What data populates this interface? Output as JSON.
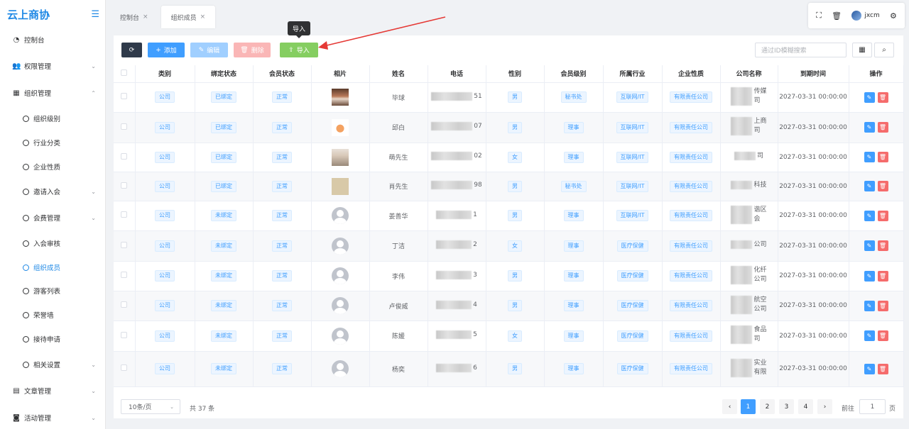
{
  "app": {
    "logo": "云上商协"
  },
  "sidebar": {
    "items": [
      {
        "label": "控制台",
        "icon": "dashboard-icon"
      },
      {
        "label": "权限管理",
        "icon": "users-icon"
      },
      {
        "label": "组织管理",
        "icon": "grid-icon"
      },
      {
        "label": "文章管理",
        "icon": "clipboard-icon"
      },
      {
        "label": "活动管理",
        "icon": "calendar-icon"
      }
    ],
    "sub_items": [
      {
        "label": "组织级别"
      },
      {
        "label": "行业分类"
      },
      {
        "label": "企业性质"
      },
      {
        "label": "邀请入会"
      },
      {
        "label": "会费管理"
      },
      {
        "label": "入会审核"
      },
      {
        "label": "组织成员"
      },
      {
        "label": "游客列表"
      },
      {
        "label": "荣誉墙"
      },
      {
        "label": "接待申请"
      },
      {
        "label": "相关设置"
      }
    ]
  },
  "tabs": [
    {
      "label": "控制台"
    },
    {
      "label": "组织成员"
    }
  ],
  "topbar": {
    "username": "jxcm"
  },
  "toolbar": {
    "add": "添加",
    "edit": "编辑",
    "delete": "删除",
    "import": "导入",
    "tooltip": "导入",
    "search_placeholder": "通过ID模糊搜索"
  },
  "table": {
    "headers": [
      "类别",
      "绑定状态",
      "会员状态",
      "相片",
      "姓名",
      "电话",
      "性别",
      "会员级别",
      "所属行业",
      "企业性质",
      "公司名称",
      "到期时间",
      "操作"
    ],
    "rows": [
      {
        "category": "公司",
        "bind": "已绑定",
        "status": "正常",
        "name": "毕球",
        "phone_tail": "51",
        "gender": "男",
        "level": "秘书处",
        "industry": "互联网/IT",
        "nature": "有限责任公司",
        "company": [
          "传媒",
          "司"
        ],
        "expire": "2027-03-31 00:00:00"
      },
      {
        "category": "公司",
        "bind": "已绑定",
        "status": "正常",
        "name": "邱白",
        "phone_tail": "07",
        "gender": "男",
        "level": "理事",
        "industry": "互联网/IT",
        "nature": "有限责任公司",
        "company": [
          "上商",
          "司"
        ],
        "expire": "2027-03-31 00:00:00"
      },
      {
        "category": "公司",
        "bind": "已绑定",
        "status": "正常",
        "name": "萌先生",
        "phone_tail": "02",
        "gender": "女",
        "level": "理事",
        "industry": "互联网/IT",
        "nature": "有限责任公司",
        "company": [
          "司"
        ],
        "expire": "2027-03-31 00:00:00"
      },
      {
        "category": "公司",
        "bind": "已绑定",
        "status": "正常",
        "name": "肖先生",
        "phone_tail": "98",
        "gender": "男",
        "level": "秘书处",
        "industry": "互联网/IT",
        "nature": "有限责任公司",
        "company": [
          "科技"
        ],
        "expire": "2027-03-31 00:00:00"
      },
      {
        "category": "公司",
        "bind": "未绑定",
        "status": "正常",
        "name": "姜善华",
        "phone_tail": "1",
        "gender": "男",
        "level": "理事",
        "industry": "互联网/IT",
        "nature": "有限责任公司",
        "company": [
          "谐区",
          "会"
        ],
        "expire": "2027-03-31 00:00:00"
      },
      {
        "category": "公司",
        "bind": "未绑定",
        "status": "正常",
        "name": "丁洁",
        "phone_tail": "2",
        "gender": "女",
        "level": "理事",
        "industry": "医疗保健",
        "nature": "有限责任公司",
        "company": [
          "公司"
        ],
        "expire": "2027-03-31 00:00:00"
      },
      {
        "category": "公司",
        "bind": "未绑定",
        "status": "正常",
        "name": "李伟",
        "phone_tail": "3",
        "gender": "男",
        "level": "理事",
        "industry": "医疗保健",
        "nature": "有限责任公司",
        "company": [
          "化纤",
          "公司"
        ],
        "expire": "2027-03-31 00:00:00"
      },
      {
        "category": "公司",
        "bind": "未绑定",
        "status": "正常",
        "name": "卢俊威",
        "phone_tail": "4",
        "gender": "男",
        "level": "理事",
        "industry": "医疗保健",
        "nature": "有限责任公司",
        "company": [
          "航空",
          "公司"
        ],
        "expire": "2027-03-31 00:00:00"
      },
      {
        "category": "公司",
        "bind": "未绑定",
        "status": "正常",
        "name": "陈媛",
        "phone_tail": "5",
        "gender": "女",
        "level": "理事",
        "industry": "医疗保健",
        "nature": "有限责任公司",
        "company": [
          "食品",
          "司"
        ],
        "expire": "2027-03-31 00:00:00"
      },
      {
        "category": "公司",
        "bind": "未绑定",
        "status": "正常",
        "name": "杨奕",
        "phone_tail": "6",
        "gender": "男",
        "level": "理事",
        "industry": "医疗保健",
        "nature": "有限责任公司",
        "company": [
          "实业",
          "有限"
        ],
        "expire": "2027-03-31 00:00:00"
      }
    ]
  },
  "pagination": {
    "page_size": "10条/页",
    "total": "共 37 条",
    "pages": [
      "1",
      "2",
      "3",
      "4"
    ],
    "prev": "‹",
    "next": "›",
    "goto_label": "前往",
    "goto_value": "1",
    "goto_suffix": "页"
  },
  "colors": {
    "primary": "#409eff",
    "add": "#409eff",
    "edit_disabled": "#a0cfff",
    "delete_disabled": "#fab6b6",
    "import": "#85ce61",
    "refresh": "#2f3a4a"
  }
}
